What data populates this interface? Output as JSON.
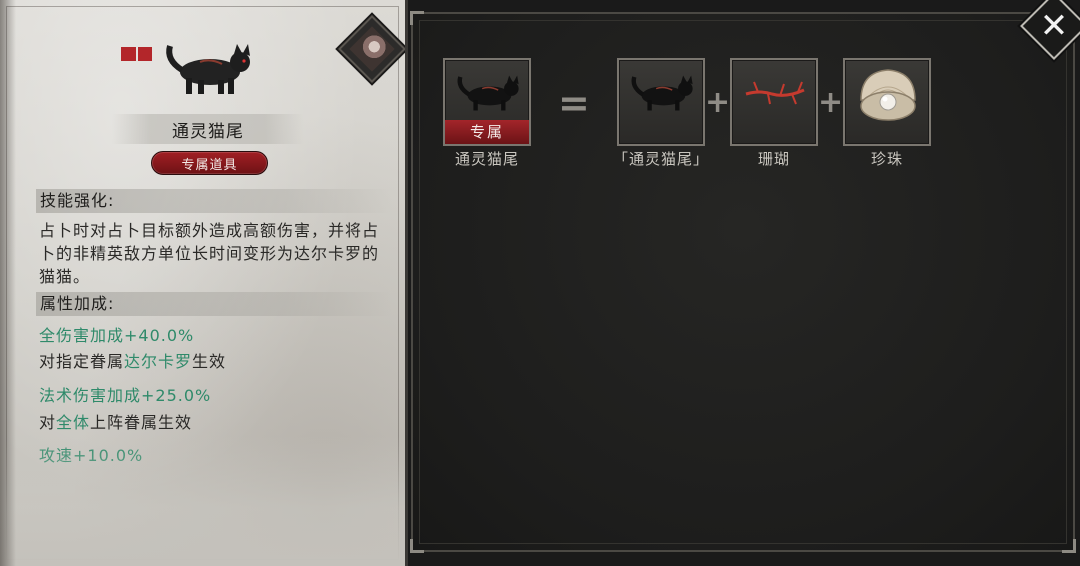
{
  "detail": {
    "item_name": "通灵猫尾",
    "type_badge": "专属道具",
    "skill_header": "技能强化:",
    "skill_desc": "占卜时对占卜目标额外造成高额伤害，并将占卜的非精英敌方单位长时间变形为达尔卡罗的猫猫。",
    "attr_header": "属性加成:",
    "stats": [
      {
        "value": "全伤害加成+40.0%",
        "note_prefix": "对指定眷属",
        "note_highlight": "达尔卡罗",
        "note_suffix": "生效"
      },
      {
        "value": "法术伤害加成+25.0%",
        "note_prefix": "对",
        "note_highlight": "全体",
        "note_suffix": "上阵眷属生效"
      },
      {
        "value": "攻速+10.0%"
      }
    ]
  },
  "recipe": {
    "result": {
      "name": "通灵猫尾",
      "badge": "专属",
      "icon": "black-cat-icon"
    },
    "equals_symbol": "=",
    "plus_symbol": "+",
    "ingredients": [
      {
        "name": "「通灵猫尾」",
        "icon": "black-cat-icon"
      },
      {
        "name": "珊瑚",
        "icon": "coral-icon"
      },
      {
        "name": "珍珠",
        "icon": "pearl-icon"
      }
    ]
  },
  "close_label": "✕",
  "colors": {
    "accent_red": "#a11f24",
    "stat_green": "#2f8a6a",
    "parchment": "#d6d4cf",
    "dark_panel": "#1f1f1e"
  }
}
